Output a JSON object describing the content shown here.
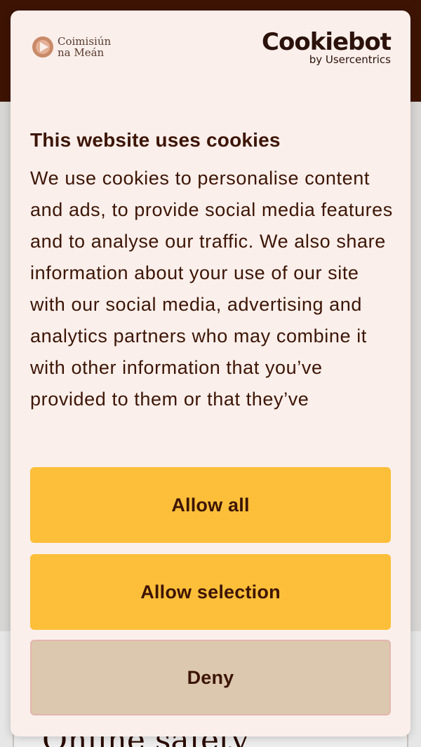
{
  "background": {
    "heading": "Online safety"
  },
  "dialog": {
    "brand": {
      "line1": "Coimisiún",
      "line2": "na Meán",
      "icon": "brand-logo-icon"
    },
    "cookiebot": {
      "name": "Cookiebot",
      "byline": "by Usercentrics"
    },
    "title": "This website uses cookies",
    "body": "We use cookies to personalise content and ads, to provide social media features and to analyse our traffic. We also share information about your use of our site with our social media, advertising and analytics partners who may combine it with other information that you’ve provided to them or that they’ve",
    "buttons": {
      "allow_all": "Allow all",
      "allow_selection": "Allow selection",
      "deny": "Deny"
    }
  },
  "colors": {
    "header_bg": "#3d1404",
    "dialog_bg": "#faefeb",
    "primary_button": "#fdbf39",
    "secondary_button": "#dbc8ae",
    "text": "#3d1505"
  }
}
